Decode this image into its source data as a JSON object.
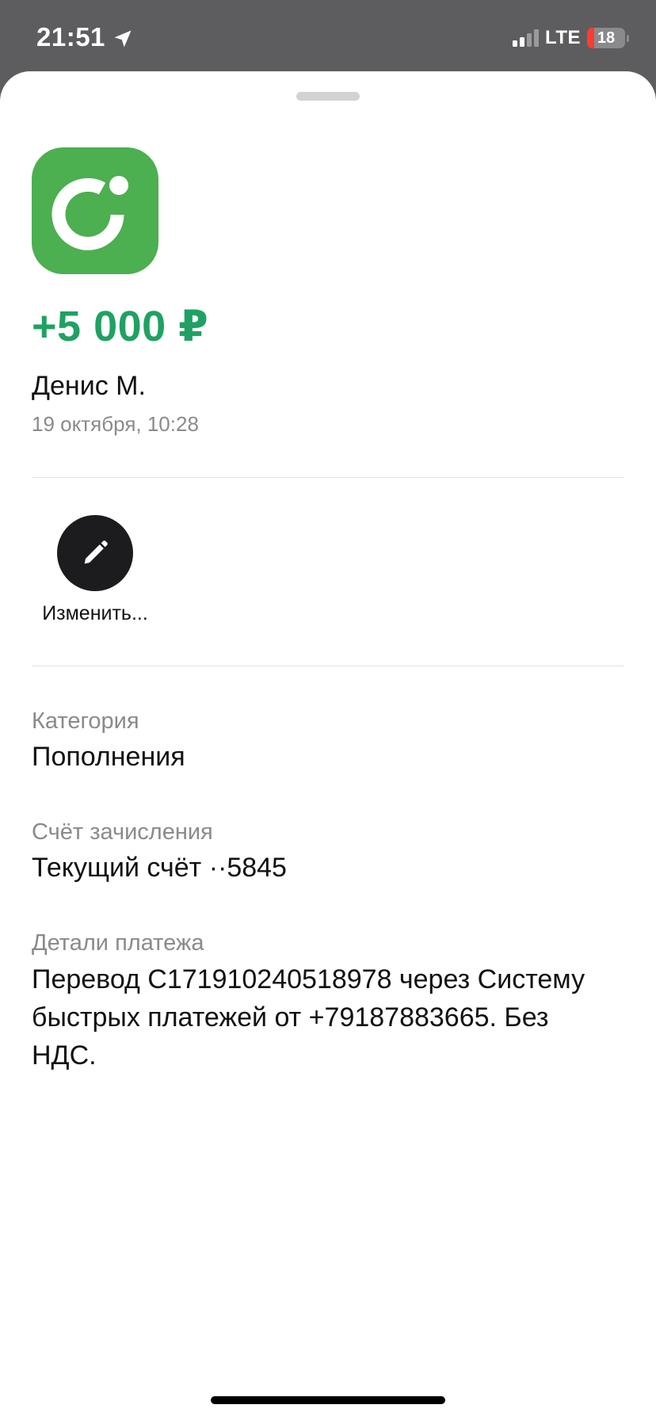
{
  "status_bar": {
    "time": "21:51",
    "network": "LTE",
    "battery_level": "18",
    "battery_percent": 18,
    "signal_bars": 2,
    "icons": [
      "location-arrow-icon",
      "signal-bars-icon",
      "battery-icon"
    ]
  },
  "transaction": {
    "merchant_logo_icon": "bank-logo-icon",
    "amount": "+5 000 ₽",
    "sender": "Денис М.",
    "date": "19 октября, 10:28"
  },
  "actions": {
    "edit_label": "Изменить...",
    "edit_icon": "pencil-icon"
  },
  "details": {
    "category": {
      "label": "Категория",
      "value": "Пополнения"
    },
    "account": {
      "label": "Счёт зачисления",
      "value": "Текущий счёт ··5845"
    },
    "payment_details": {
      "label": "Детали платежа",
      "value": "Перевод C171910240518978 через Систему быстрых платежей от +79187883665. Без НДС."
    }
  },
  "colors": {
    "amount_green": "#20a163",
    "logo_green": "#4caf50",
    "status_bar_bg": "#5d5d5f",
    "edit_button_bg": "#1c1c1e",
    "secondary_text": "#8a8a8e"
  }
}
